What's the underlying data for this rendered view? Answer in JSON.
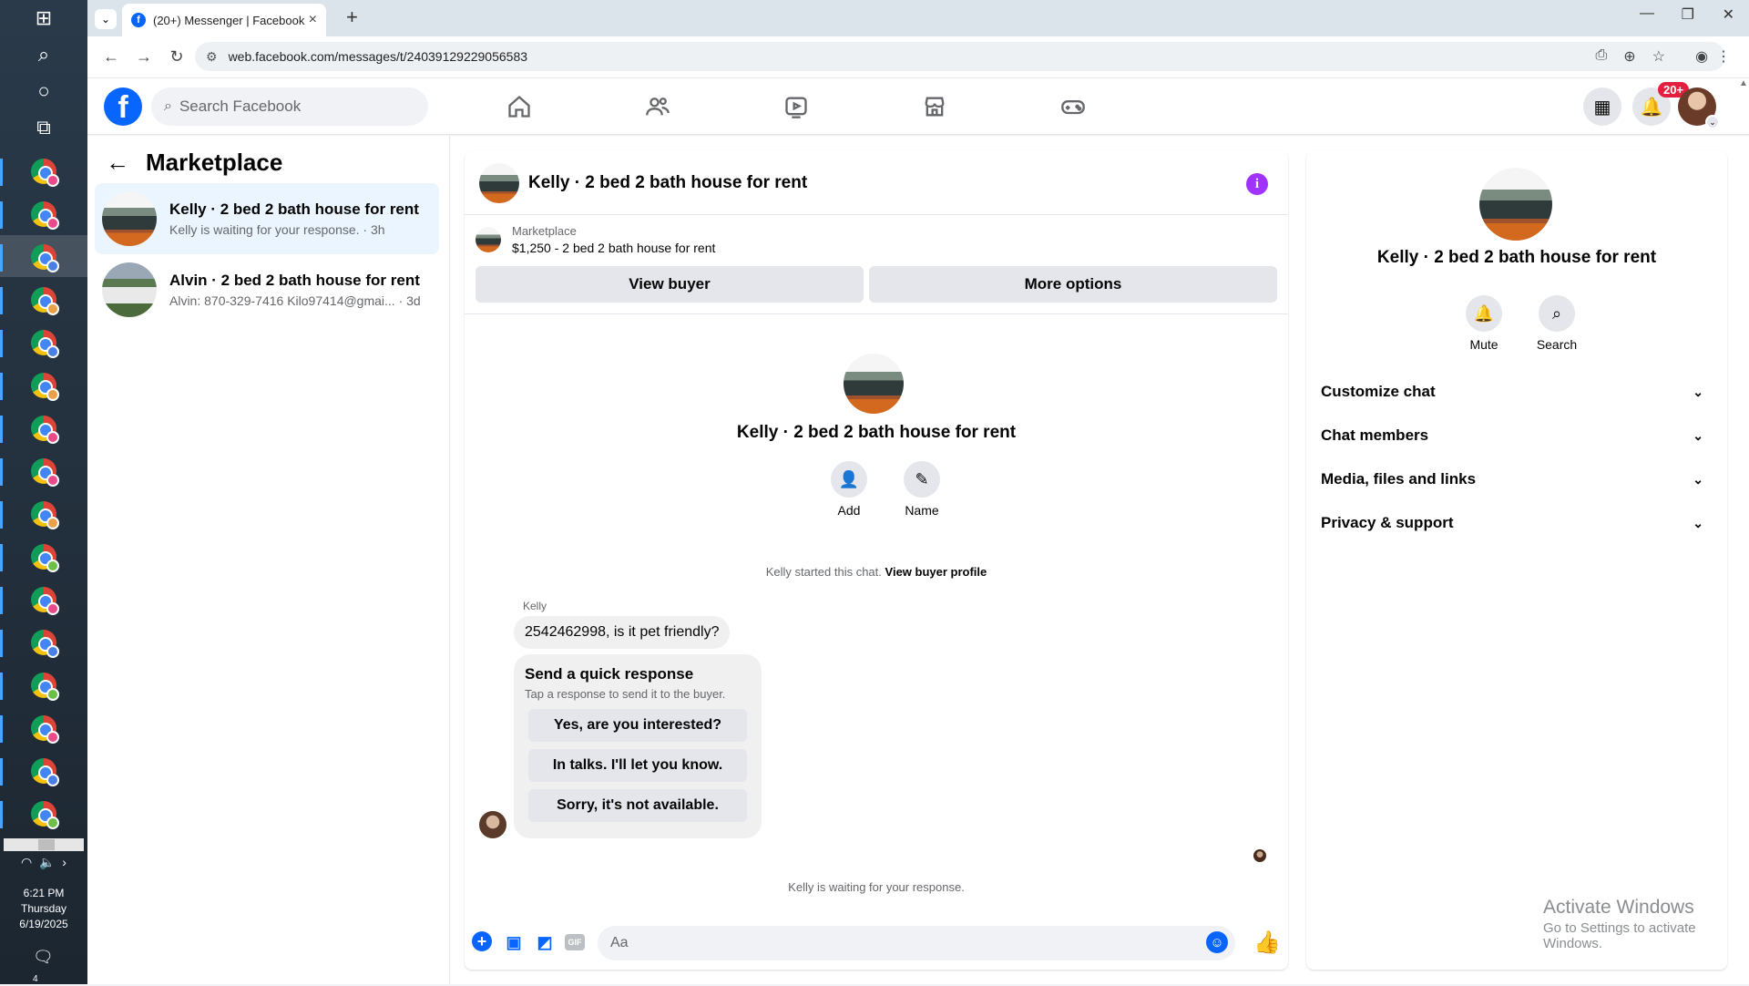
{
  "taskbar": {
    "clock_time": "6:21 PM",
    "clock_day": "Thursday",
    "clock_date": "6/19/2025",
    "notif_count": "4"
  },
  "browser": {
    "tab_title": "(20+) Messenger | Facebook",
    "url": "web.facebook.com/messages/t/24039129229056583"
  },
  "fb": {
    "search_placeholder": "Search Facebook",
    "notif_badge": "20+"
  },
  "left": {
    "title": "Marketplace",
    "conversations": [
      {
        "title": "Kelly · 2 bed 2 bath house for rent",
        "sub": "Kelly is waiting for your response. · 3h"
      },
      {
        "title": "Alvin · 2 bed 2 bath house for rent",
        "sub": "Alvin: 870-329-7416 Kilo97414@gmai... · 3d"
      }
    ]
  },
  "chat": {
    "header_name": "Kelly · 2 bed 2 bath house for rent",
    "marketplace_label": "Marketplace",
    "listing": "$1,250 - 2 bed 2 bath house for rent",
    "view_buyer": "View buyer",
    "more_options": "More options",
    "intro_name": "Kelly · 2 bed 2 bath house for rent",
    "add_label": "Add",
    "name_label": "Name",
    "started_text": "Kelly started this chat.",
    "view_profile": "View buyer profile",
    "sender": "Kelly",
    "message": "2542462998, is it pet friendly?",
    "quick_title": "Send a quick response",
    "quick_sub": "Tap a response to send it to the buyer.",
    "quick_responses": [
      "Yes, are you interested?",
      "In talks. I'll let you know.",
      "Sorry, it's not available."
    ],
    "waiting": "Kelly is waiting for your response.",
    "composer_placeholder": "Aa",
    "gif_label": "GIF"
  },
  "right": {
    "name": "Kelly · 2 bed 2 bath house for rent",
    "mute": "Mute",
    "search": "Search",
    "sections": [
      "Customize chat",
      "Chat members",
      "Media, files and links",
      "Privacy & support"
    ]
  },
  "watermark": {
    "line1": "Activate Windows",
    "line2": "Go to Settings to activate Windows."
  },
  "colors": {
    "fb_blue": "#0866ff",
    "info_purple": "#a033ff",
    "badge_red": "#e41e3f"
  }
}
